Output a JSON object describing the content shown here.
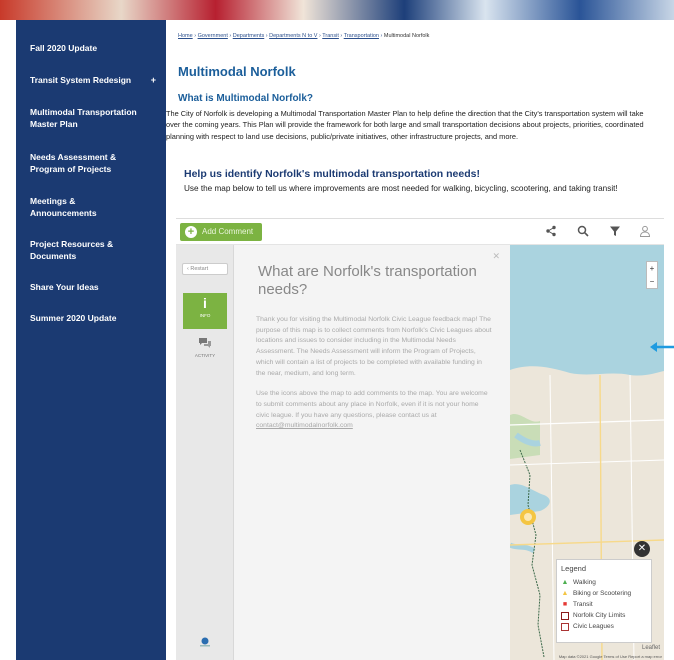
{
  "sidebar": {
    "items": [
      {
        "label": "Fall 2020 Update"
      },
      {
        "label": "Transit System Redesign",
        "chevron": "+"
      },
      {
        "label": "Multimodal Transportation Master Plan"
      },
      {
        "label": "Needs Assessment & Program of Projects"
      },
      {
        "label": "Meetings & Announcements"
      },
      {
        "label": "Project Resources & Documents"
      },
      {
        "label": "Share Your Ideas"
      },
      {
        "label": "Summer 2020 Update"
      }
    ]
  },
  "breadcrumb": {
    "items": [
      "Home",
      "Government",
      "Departments",
      "Departments N to V",
      "Transit",
      "Transportation"
    ],
    "separator": "›",
    "current": "Multimodal Norfolk"
  },
  "page": {
    "title": "Multimodal Norfolk",
    "section_heading": "What is Multimodal Norfolk?",
    "intro": "The City of Norfolk is developing a Multimodal Transportation Master Plan to help define the direction that the City's transportation system will take over the coming years. This Plan will provide the framework for both large and small transportation decisions about projects, priorities, coordinated planning with respect to land use decisions, public/private initiatives, other infrastructure projects, and more.",
    "cta_heading": "Help us identify Norfolk's multimodal transportation needs!",
    "cta_body": "Use the map below to tell us where improvements are most needed for walking, bicycling, scootering, and taking transit!"
  },
  "mapapp": {
    "add_comment_label": "Add Comment",
    "restart_label": "Restart",
    "info_tab_label": "INFO",
    "activity_tab_label": "ACTIVITY",
    "panel_heading": "What are Norfolk's transportation needs?",
    "panel_paragraph_1": "Thank you for visiting the Multimodal Norfolk Civic League feedback map! The purpose of this map is to collect comments from Norfolk's Civic Leagues about locations and issues to consider including in the Multimodal Needs Assessment. The Needs Assessment will inform the Program of Projects, which will contain a list of projects to be completed with available funding in the near, medium, and long term.",
    "panel_paragraph_2": "Use the icons above the map to add comments to the map. You are welcome to submit comments about any place in Norfolk, even if it is not your home civic league. If you have any questions, please contact us at",
    "panel_email": "contact@multimodalnorfolk.com",
    "legend_title": "Legend",
    "legend_items": [
      {
        "label": "Walking",
        "color": "#4caf50",
        "icon": "walking-icon"
      },
      {
        "label": "Biking or Scootering",
        "color": "#f4c542",
        "icon": "bike-icon"
      },
      {
        "label": "Transit",
        "color": "#e53935",
        "icon": "bus-icon"
      },
      {
        "label": "Norfolk City Limits",
        "color": "#8b1a1a",
        "icon": "boundary-swatch"
      },
      {
        "label": "Civic Leagues",
        "color": "#a33",
        "icon": "boundary-swatch"
      }
    ],
    "zoom_in": "+",
    "zoom_out": "−",
    "attribution": "Map data ©2021 Google   Terms of Use   Report a map error",
    "leaflet_label": "Leaflet"
  }
}
